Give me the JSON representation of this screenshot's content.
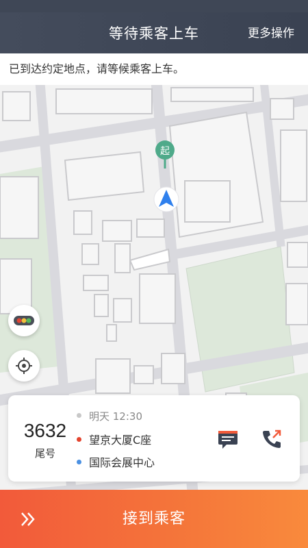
{
  "header": {
    "title": "等待乘客上车",
    "more_label": "更多操作"
  },
  "notice": {
    "text": "已到达约定地点，请等候乘客上车。"
  },
  "map": {
    "start_marker_label": "起",
    "icons": [
      "start-pin-icon",
      "navigation-arrow-icon",
      "traffic-light-icon",
      "locate-icon"
    ],
    "colors": {
      "background": "#f2f2f2",
      "road": "#d9d9de",
      "building_fill": "#f6f6f6",
      "building_stroke": "#c9c9cc",
      "park": "#dde8da",
      "pin": "#4faa8a",
      "arrow": "#2f80ed"
    }
  },
  "order_card": {
    "tail_number": "3632",
    "tail_label": "尾号",
    "time": "明天 12:30",
    "from": "望京大厦C座",
    "to": "国际会展中心",
    "icons": [
      "clock-icon",
      "message-icon",
      "phone-icon"
    ],
    "colors": {
      "from_dot": "#e4442e",
      "to_dot": "#4a90e2",
      "message_icon": "#3a4252",
      "phone_icon": "#3a4252",
      "accent": "#f25a3a"
    }
  },
  "action": {
    "pickup_label": "接到乘客",
    "icon": "double-chevron-right-icon",
    "gradient_from": "#f25a3a",
    "gradient_to": "#f98a3c"
  }
}
